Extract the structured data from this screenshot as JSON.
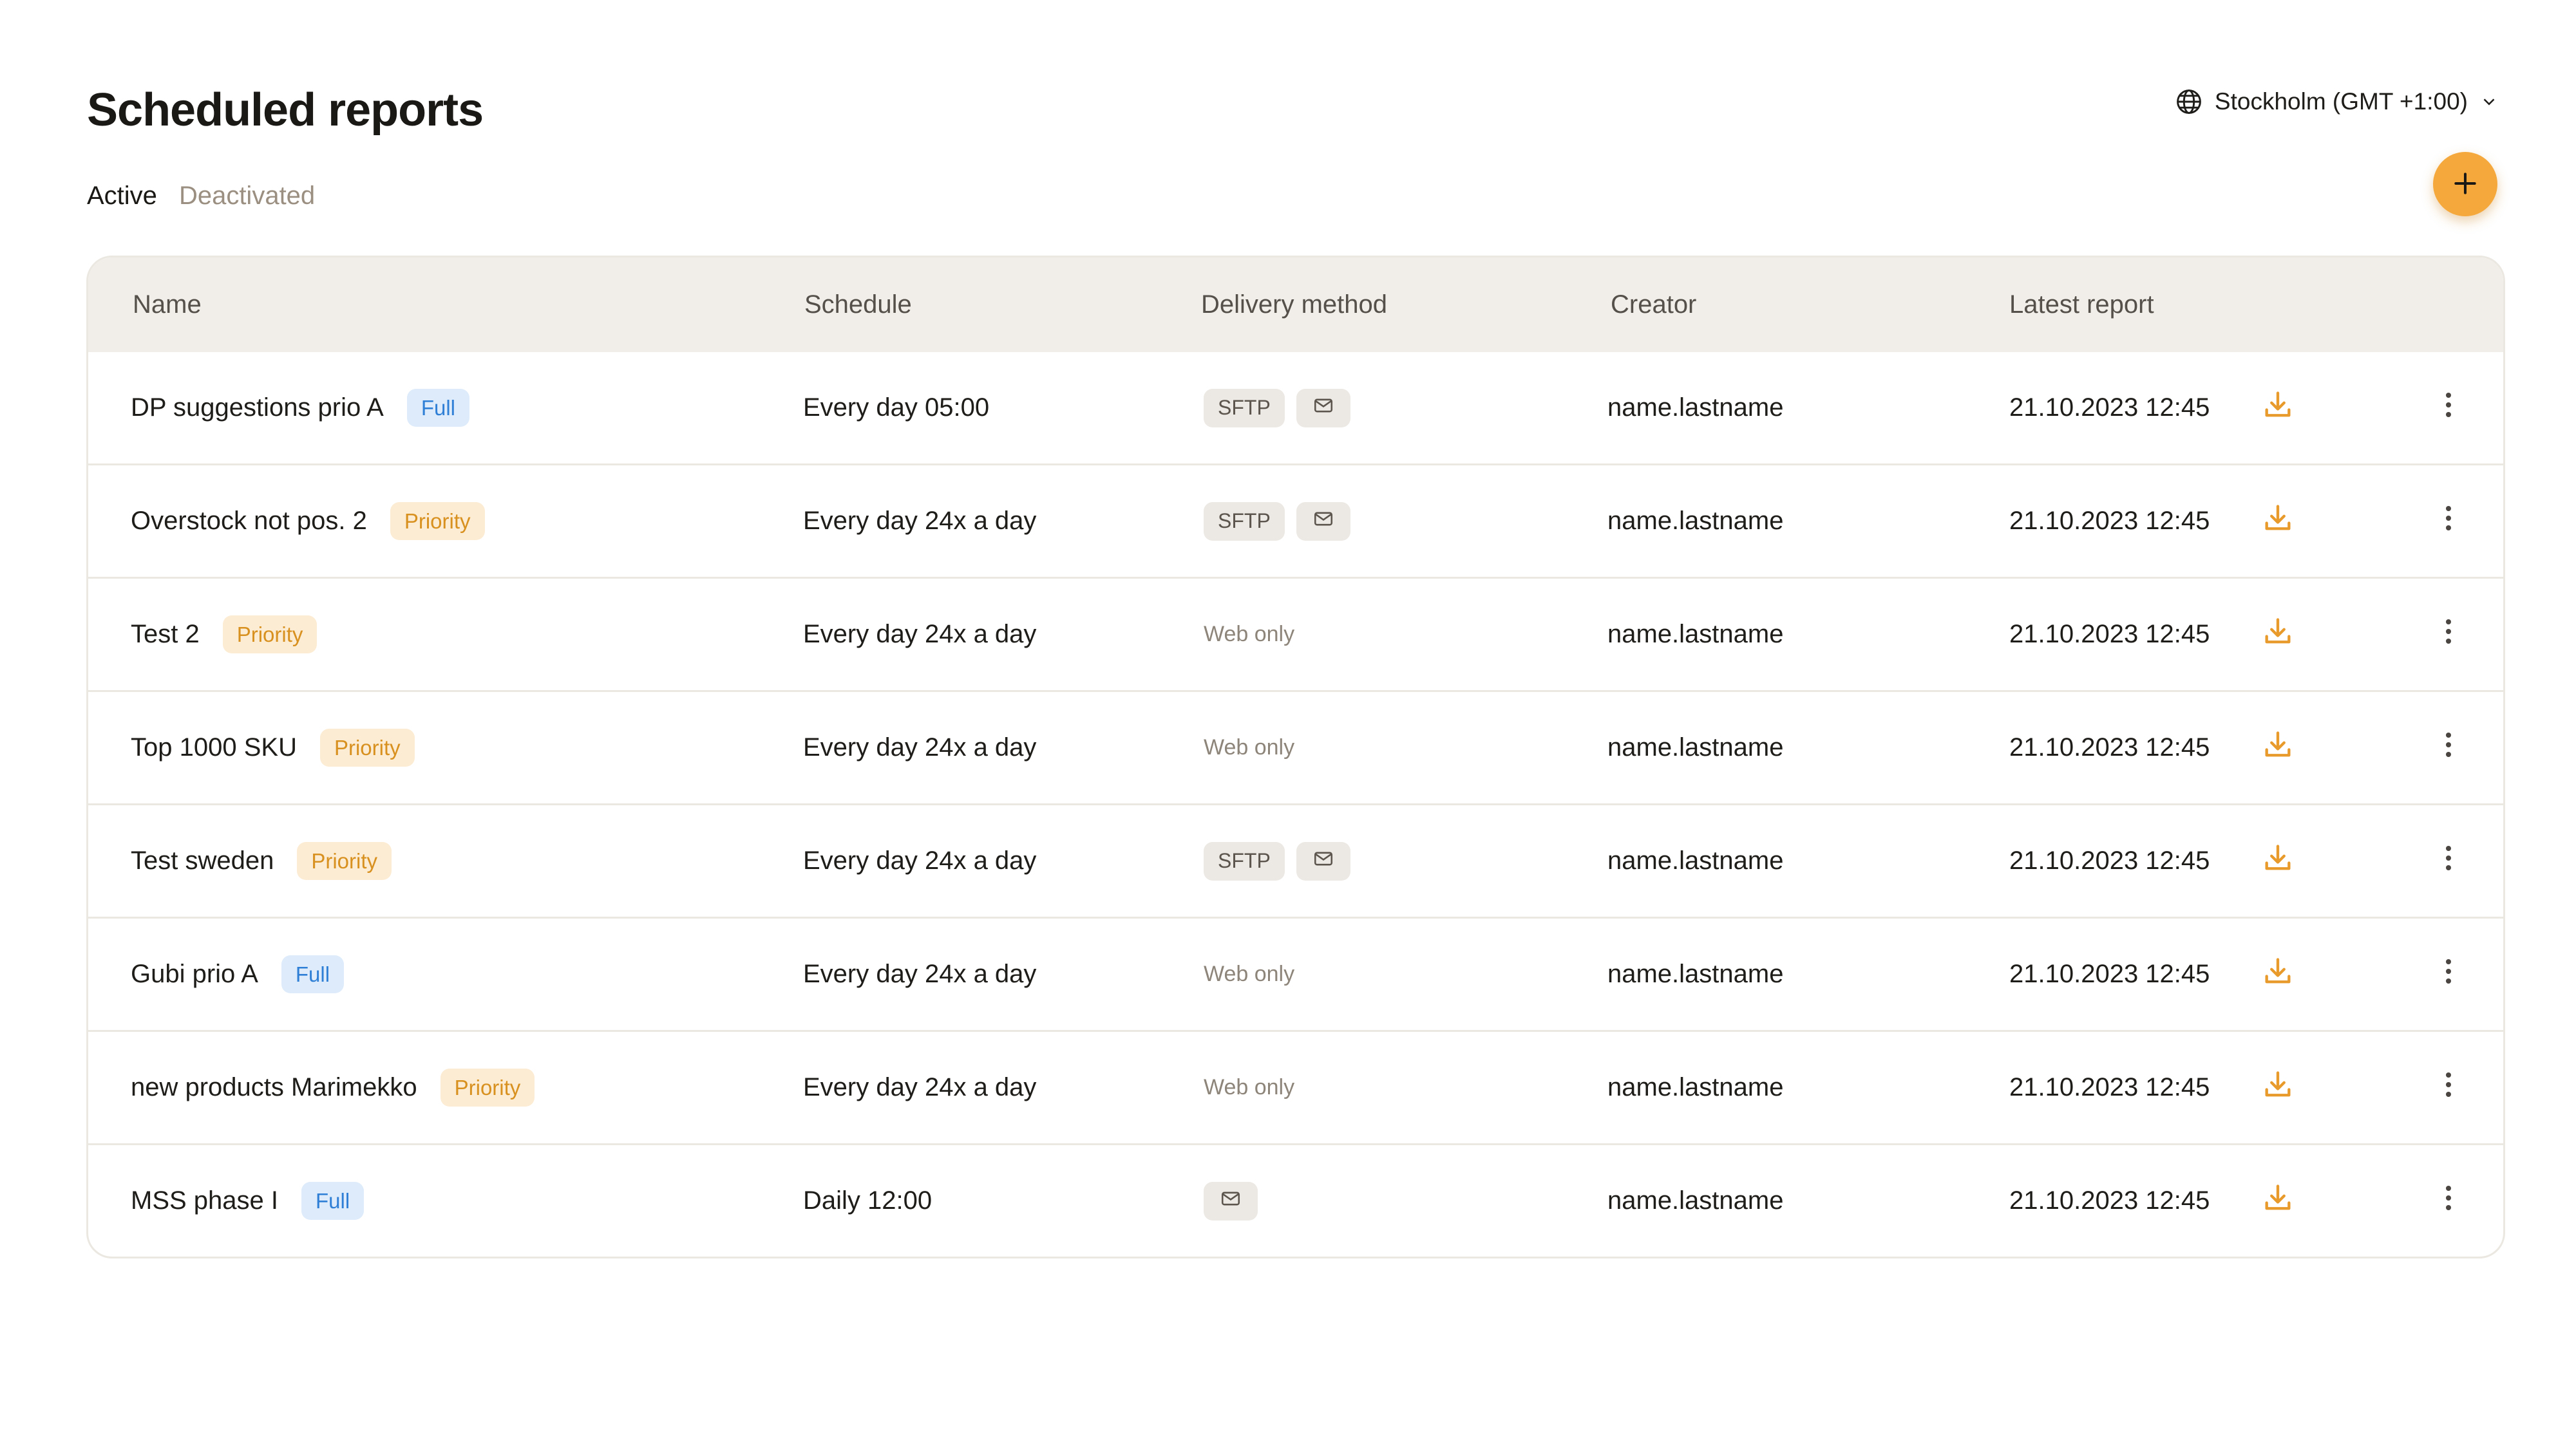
{
  "page": {
    "title": "Scheduled reports"
  },
  "timezone": {
    "label": "Stockholm (GMT +1:00)",
    "icon": "globe-icon"
  },
  "tabs": [
    {
      "label": "Active",
      "active": true
    },
    {
      "label": "Deactivated",
      "active": false
    }
  ],
  "add_button": {
    "icon": "plus-icon"
  },
  "columns": {
    "name": "Name",
    "schedule": "Schedule",
    "delivery": "Delivery method",
    "creator": "Creator",
    "latest": "Latest report"
  },
  "colors": {
    "accent": "#f5a83c",
    "full_badge_bg": "#ddebfa",
    "full_badge_text": "#2f7fd6",
    "priority_badge_bg": "#fcecd3",
    "priority_badge_text": "#d8901f"
  },
  "rows": [
    {
      "name": "DP suggestions prio A",
      "badge": "Full",
      "badge_type": "full",
      "schedule": "Every day 05:00",
      "delivery": {
        "sftp": "SFTP",
        "mail": true,
        "web_only": ""
      },
      "creator": "name.lastname",
      "latest": "21.10.2023 12:45"
    },
    {
      "name": "Overstock not pos. 2",
      "badge": "Priority",
      "badge_type": "priority",
      "schedule": "Every day 24x a day",
      "delivery": {
        "sftp": "SFTP",
        "mail": true,
        "web_only": ""
      },
      "creator": "name.lastname",
      "latest": "21.10.2023 12:45"
    },
    {
      "name": "Test 2",
      "badge": "Priority",
      "badge_type": "priority",
      "schedule": "Every day 24x a day",
      "delivery": {
        "sftp": "",
        "mail": false,
        "web_only": "Web only"
      },
      "creator": "name.lastname",
      "latest": "21.10.2023 12:45"
    },
    {
      "name": "Top 1000 SKU",
      "badge": "Priority",
      "badge_type": "priority",
      "schedule": "Every day 24x a day",
      "delivery": {
        "sftp": "",
        "mail": false,
        "web_only": "Web only"
      },
      "creator": "name.lastname",
      "latest": "21.10.2023 12:45"
    },
    {
      "name": "Test sweden",
      "badge": "Priority",
      "badge_type": "priority",
      "schedule": "Every day 24x a day",
      "delivery": {
        "sftp": "SFTP",
        "mail": true,
        "web_only": ""
      },
      "creator": "name.lastname",
      "latest": "21.10.2023 12:45"
    },
    {
      "name": "Gubi prio A",
      "badge": "Full",
      "badge_type": "full",
      "schedule": "Every day 24x a day",
      "delivery": {
        "sftp": "",
        "mail": false,
        "web_only": "Web only"
      },
      "creator": "name.lastname",
      "latest": "21.10.2023 12:45"
    },
    {
      "name": "new products Marimekko",
      "badge": "Priority",
      "badge_type": "priority",
      "schedule": "Every day 24x a day",
      "delivery": {
        "sftp": "",
        "mail": false,
        "web_only": "Web only"
      },
      "creator": "name.lastname",
      "latest": "21.10.2023 12:45"
    },
    {
      "name": "MSS phase I",
      "badge": "Full",
      "badge_type": "full",
      "schedule": "Daily 12:00",
      "delivery": {
        "sftp": "",
        "mail": true,
        "web_only": ""
      },
      "creator": "name.lastname",
      "latest": "21.10.2023 12:45"
    }
  ]
}
